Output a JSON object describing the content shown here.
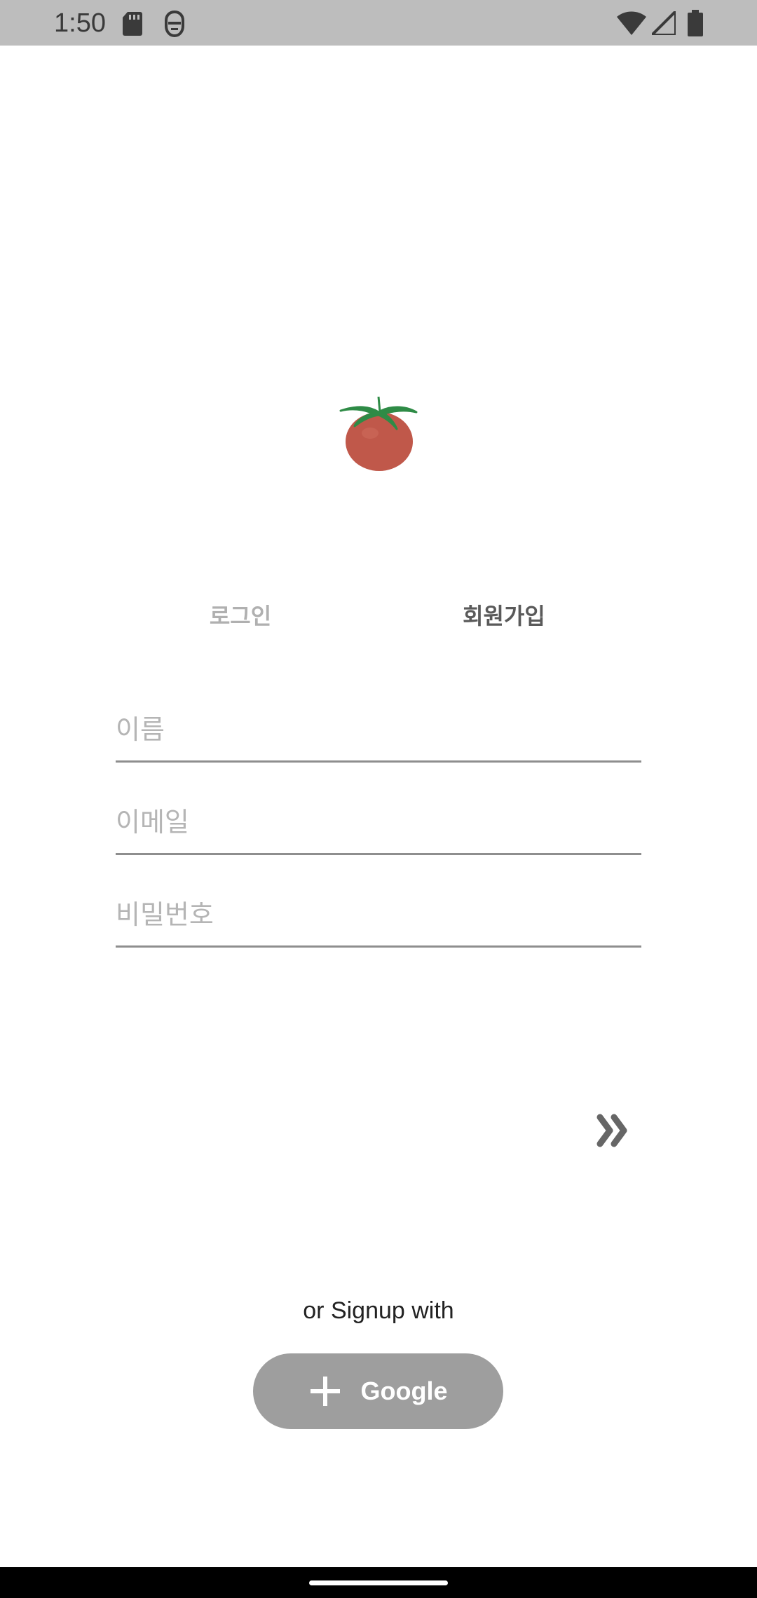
{
  "status_bar": {
    "time": "1:50",
    "icons": [
      "sd-card-icon",
      "face-icon",
      "wifi-icon",
      "signal-icon",
      "battery-icon"
    ],
    "background": "#bdbdbd"
  },
  "logo": {
    "icon": "tomato-logo-icon",
    "fruit_color": "#c0584a",
    "stem_color": "#2e8b46"
  },
  "tabs": [
    {
      "label": "로그인",
      "selected": false
    },
    {
      "label": "회원가입",
      "selected": true
    }
  ],
  "form": {
    "name_placeholder": "이름",
    "email_placeholder": "이메일",
    "password_placeholder": "비밀번호"
  },
  "next_icon": "double-chevron-right-icon",
  "social": {
    "prompt": "or Signup with",
    "google_label": "Google",
    "google_icon": "plus-icon",
    "button_color": "#9e9e9e"
  }
}
